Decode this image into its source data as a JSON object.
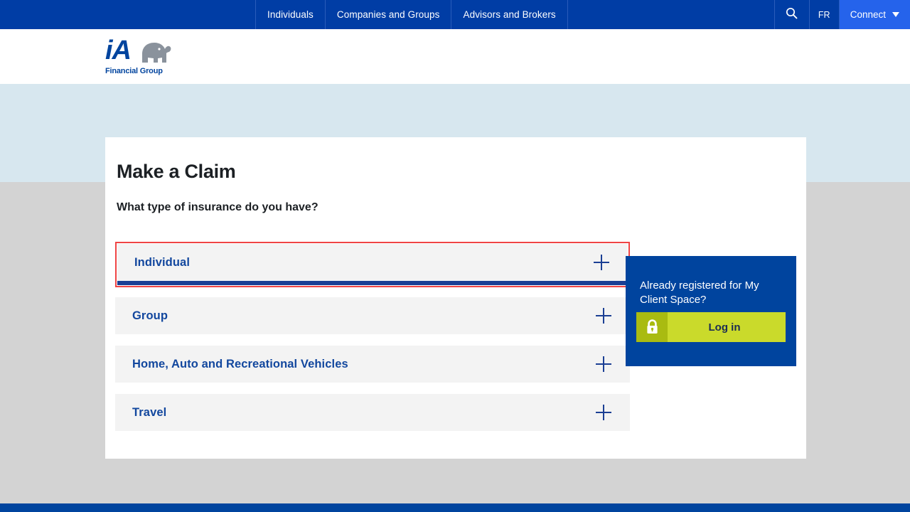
{
  "topbar": {
    "nav_items": [
      {
        "label": "Individuals"
      },
      {
        "label": "Companies and Groups"
      },
      {
        "label": "Advisors and Brokers"
      }
    ],
    "search_icon": "search-icon",
    "language": "FR",
    "connect": "Connect",
    "caret_icon": "chevron-down-icon",
    "background_color": "#003da5",
    "connect_background_color": "#2563eb"
  },
  "header": {
    "logo_mark": "iA",
    "logo_tagline": "Financial Group",
    "logo_icon": "elephant-icon",
    "logo_color": "#00449e",
    "elephant_color": "#8a929c"
  },
  "main": {
    "title": "Make a Claim",
    "subtitle": "What type of insurance do you have?",
    "accordion": [
      {
        "label": "Individual",
        "expand_icon": "plus-icon",
        "highlighted": true
      },
      {
        "label": "Group",
        "expand_icon": "plus-icon",
        "highlighted": false
      },
      {
        "label": "Home, Auto and Recreational Vehicles",
        "expand_icon": "plus-icon",
        "highlighted": false
      },
      {
        "label": "Travel",
        "expand_icon": "plus-icon",
        "highlighted": false
      }
    ],
    "highlight_color": "#ef4444",
    "accordion_label_color": "#12479e",
    "accordion_background": "#f3f3f3"
  },
  "promo": {
    "text": "Already registered for My Client Space?",
    "login_label": "Log in",
    "lock_icon": "lock-icon",
    "background_color": "#00449e",
    "button_color": "#cada2b",
    "button_icon_color": "#a9bb11"
  },
  "page": {
    "band_blue": "#d7e7ef",
    "band_gray": "#d3d3d3",
    "footer_color": "#00449e"
  }
}
